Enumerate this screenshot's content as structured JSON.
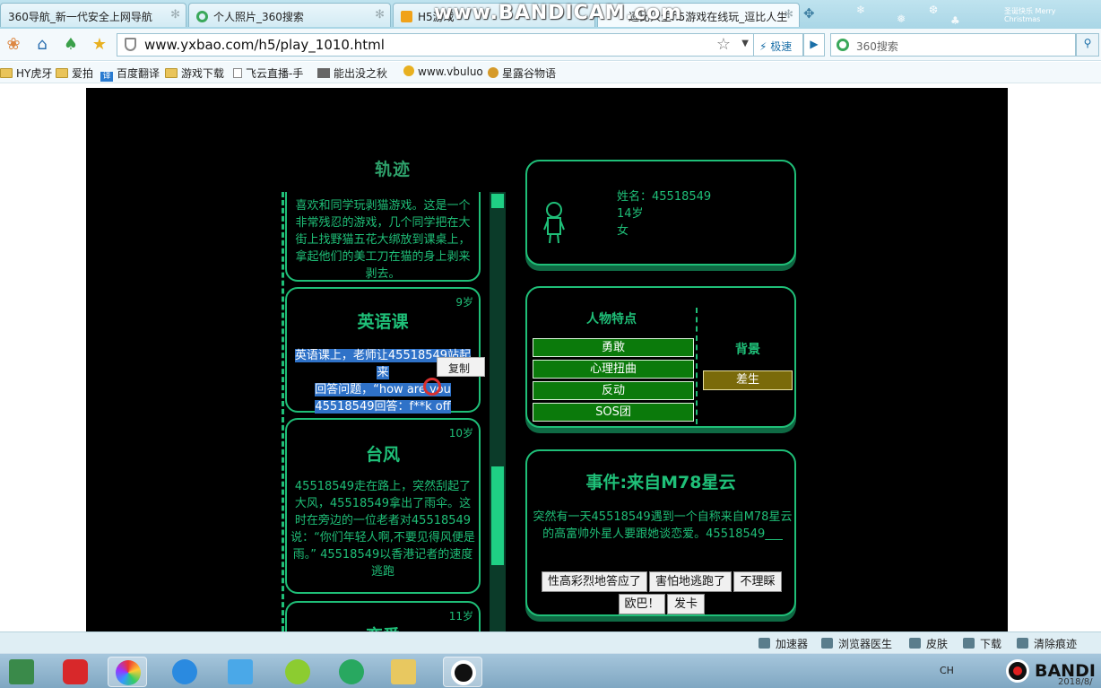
{
  "browser": {
    "tabs": [
      {
        "label": "360导航_新一代安全上网导航"
      },
      {
        "label": "个人照片_360搜索"
      },
      {
        "label": "H5游戏"
      },
      {
        "label": "逗比人生h5游戏在线玩_逗比人生"
      }
    ],
    "watermark": "www.BANDICAM.com",
    "url": "www.yxbao.com/h5/play_1010.html",
    "speed_label": "极速",
    "search_placeholder": "360搜索",
    "xmas_text": "圣诞快乐 Merry Christmas",
    "bookmarks": [
      {
        "label": "HY虎牙"
      },
      {
        "label": "爱拍"
      },
      {
        "label": "百度翻译"
      },
      {
        "label": "游戏下载"
      },
      {
        "label": "飞云直播-手"
      },
      {
        "label": "能出没之秋"
      },
      {
        "label": "www.vbuluo"
      },
      {
        "label": "星露谷物语"
      }
    ]
  },
  "game": {
    "trail_title": "轨迹",
    "cards": [
      {
        "age": "",
        "title": "",
        "text": "喜欢和同学玩剥猫游戏。这是一个非常残忍的游戏，几个同学把在大街上找野猫五花大绑放到课桌上，拿起他们的美工刀在猫的身上剥来剥去。"
      },
      {
        "age": "9岁",
        "title": "英语课",
        "text_line1": "英语课上，老师让45518549站起来",
        "text_line2": "回答问题，“how are you",
        "text_line3": "45518549回答：f**k off"
      },
      {
        "age": "10岁",
        "title": "台风",
        "text": "45518549走在路上，突然刮起了大风，45518549拿出了雨伞。这时在旁边的一位老者对45518549说：“你们年轻人啊,不要见得风便是雨。” 45518549以香港记者的速度逃跑"
      },
      {
        "age": "11岁",
        "title": "恋爱"
      }
    ],
    "context_menu": {
      "copy": "复制"
    },
    "profile": {
      "name": "姓名：45518549",
      "age": "14岁",
      "gender": "女"
    },
    "traits": {
      "title": "人物特点",
      "items": [
        "勇敢",
        "心理扭曲",
        "反动",
        "SOS团"
      ],
      "background_title": "背景",
      "background_tag": "差生"
    },
    "event": {
      "title": "事件:来自M78星云",
      "text": "突然有一天45518549遇到一个自称来自M78星云的高富帅外星人要跟她谈恋爱。45518549___",
      "options": [
        "性高彩烈地答应了",
        "害怕地逃跑了",
        "不理睬",
        "欧巴！",
        "发卡"
      ]
    }
  },
  "statusbar": {
    "items": [
      "加速器",
      "浏览器医生",
      "皮肤",
      "下载",
      "清除痕迹"
    ]
  },
  "taskbar": {
    "lang": "CH",
    "bandicam": "BANDI",
    "clock": "2018/8/"
  },
  "colors": {
    "game_green": "#1fbf78",
    "trait_bg": "#0b7a0b",
    "background_tag": "#7a6a0a",
    "selection": "#2f72c8"
  }
}
